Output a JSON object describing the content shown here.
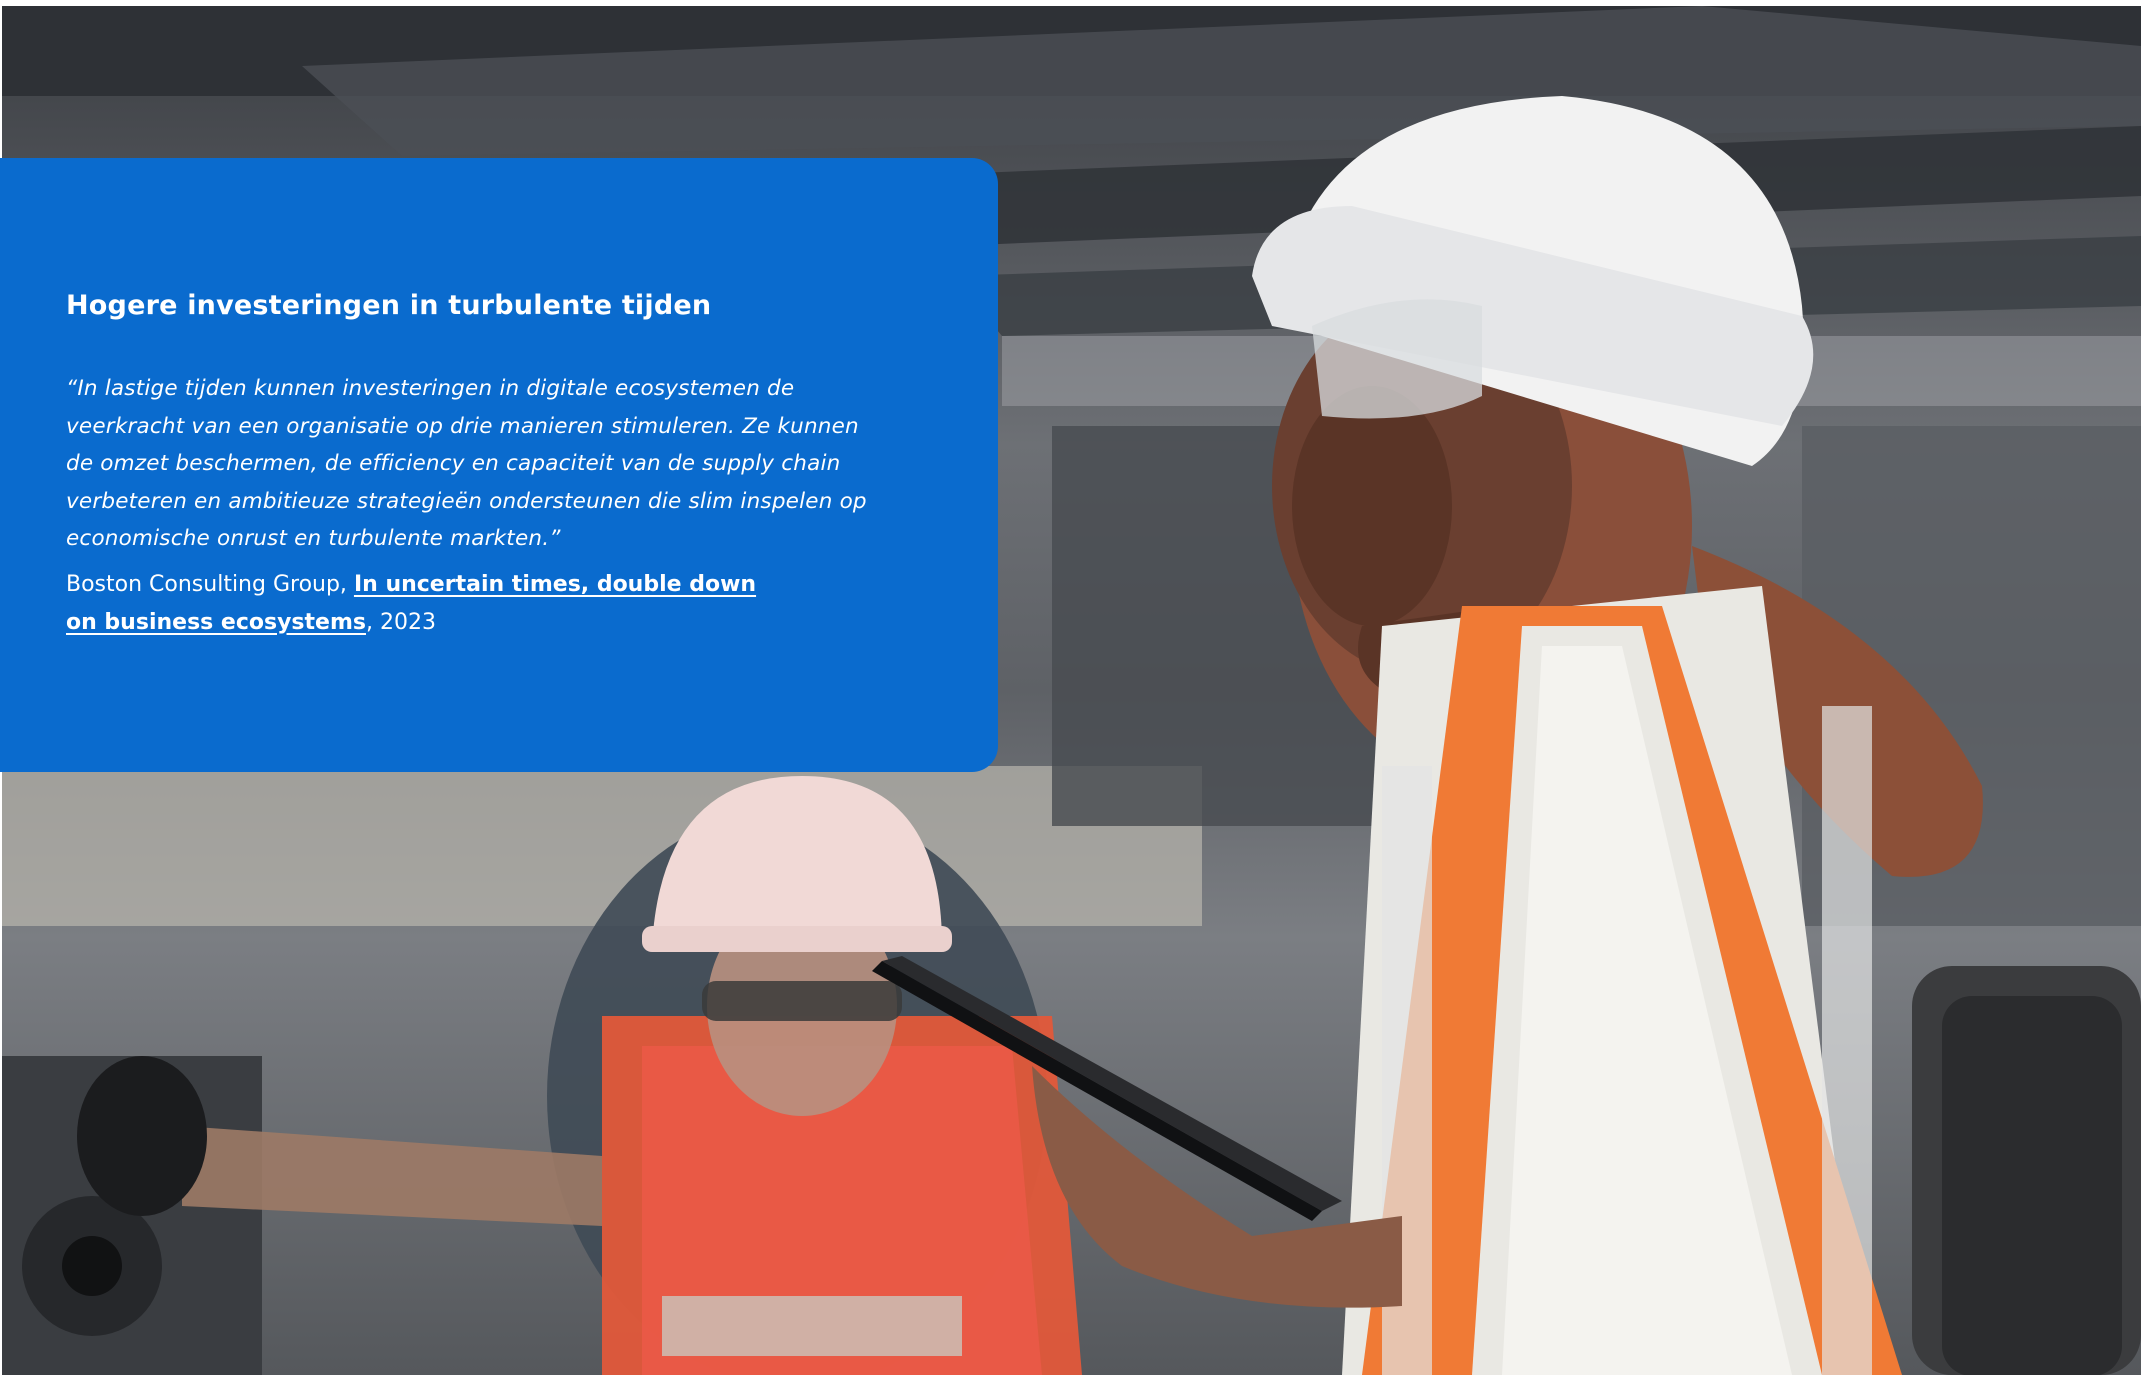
{
  "card": {
    "title": "Hogere investeringen in turbulente tijden",
    "quote": "“In lastige tijden kunnen investeringen in digitale ecosystemen de veerkracht van een organisatie op drie manieren stimuleren. Ze kunnen de omzet beschermen, de efficiency en capaciteit van de supply chain verbeteren en ambitieuze strategieën ondersteunen die slim inspelen op economische onrust en turbulente markten.”",
    "source_org": "Boston Consulting Group, ",
    "source_link": "In uncertain times, double down on business ecosystems",
    "source_year": ", 2023"
  },
  "colors": {
    "card_blue": "#0a6bce",
    "text": "#ffffff"
  }
}
